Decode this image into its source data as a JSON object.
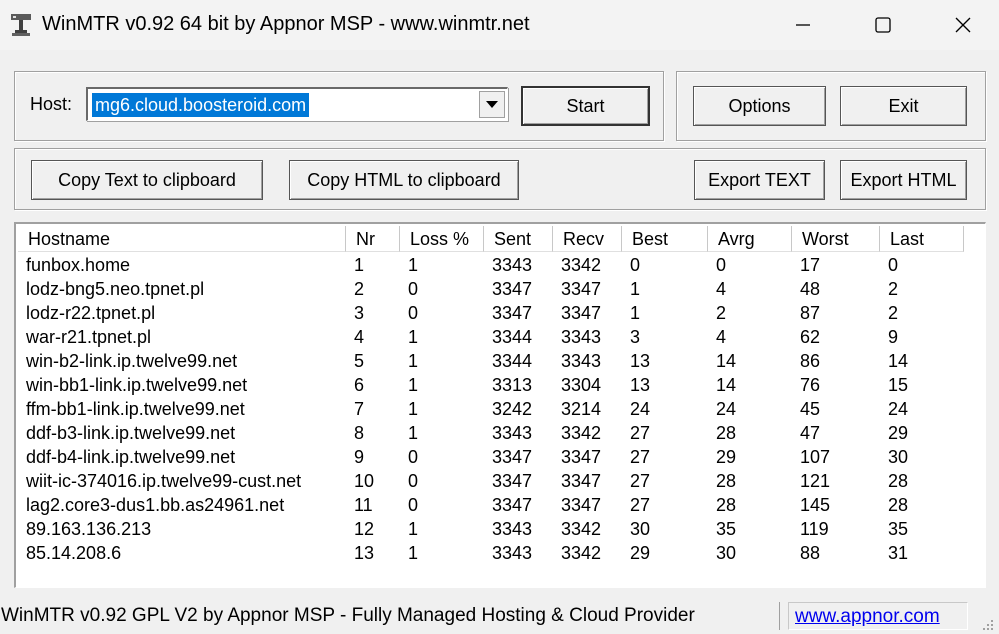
{
  "window": {
    "title": "WinMTR v0.92 64 bit by Appnor MSP - www.winmtr.net",
    "icons": {
      "app": "traceroute-app-icon",
      "minimize": "minimize-icon",
      "maximize": "maximize-icon",
      "close": "close-icon"
    }
  },
  "controls": {
    "host_label": "Host:",
    "host_value": "mg6.cloud.boosteroid.com",
    "start_label": "Start",
    "options_label": "Options",
    "exit_label": "Exit",
    "copy_text_label": "Copy Text to clipboard",
    "copy_html_label": "Copy HTML to clipboard",
    "export_text_label": "Export TEXT",
    "export_html_label": "Export HTML"
  },
  "table": {
    "columns": [
      "Hostname",
      "Nr",
      "Loss %",
      "Sent",
      "Recv",
      "Best",
      "Avrg",
      "Worst",
      "Last"
    ],
    "rows": [
      [
        "funbox.home",
        "1",
        "1",
        "3343",
        "3342",
        "0",
        "0",
        "17",
        "0"
      ],
      [
        "lodz-bng5.neo.tpnet.pl",
        "2",
        "0",
        "3347",
        "3347",
        "1",
        "4",
        "48",
        "2"
      ],
      [
        "lodz-r22.tpnet.pl",
        "3",
        "0",
        "3347",
        "3347",
        "1",
        "2",
        "87",
        "2"
      ],
      [
        "war-r21.tpnet.pl",
        "4",
        "1",
        "3344",
        "3343",
        "3",
        "4",
        "62",
        "9"
      ],
      [
        "win-b2-link.ip.twelve99.net",
        "5",
        "1",
        "3344",
        "3343",
        "13",
        "14",
        "86",
        "14"
      ],
      [
        "win-bb1-link.ip.twelve99.net",
        "6",
        "1",
        "3313",
        "3304",
        "13",
        "14",
        "76",
        "15"
      ],
      [
        "ffm-bb1-link.ip.twelve99.net",
        "7",
        "1",
        "3242",
        "3214",
        "24",
        "24",
        "45",
        "24"
      ],
      [
        "ddf-b3-link.ip.twelve99.net",
        "8",
        "1",
        "3343",
        "3342",
        "27",
        "28",
        "47",
        "29"
      ],
      [
        "ddf-b4-link.ip.twelve99.net",
        "9",
        "0",
        "3347",
        "3347",
        "27",
        "29",
        "107",
        "30"
      ],
      [
        "wiit-ic-374016.ip.twelve99-cust.net",
        "10",
        "0",
        "3347",
        "3347",
        "27",
        "28",
        "121",
        "28"
      ],
      [
        "lag2.core3-dus1.bb.as24961.net",
        "11",
        "0",
        "3347",
        "3347",
        "27",
        "28",
        "145",
        "28"
      ],
      [
        "89.163.136.213",
        "12",
        "1",
        "3343",
        "3342",
        "30",
        "35",
        "119",
        "35"
      ],
      [
        "85.14.208.6",
        "13",
        "1",
        "3343",
        "3342",
        "29",
        "30",
        "88",
        "31"
      ]
    ]
  },
  "status": {
    "text": "WinMTR v0.92 GPL V2 by Appnor MSP - Fully Managed Hosting & Cloud Provider",
    "link": "www.appnor.com"
  },
  "colors": {
    "selection": "#0078d7",
    "link": "#0000ee",
    "window_bg": "#f0f0f0"
  }
}
